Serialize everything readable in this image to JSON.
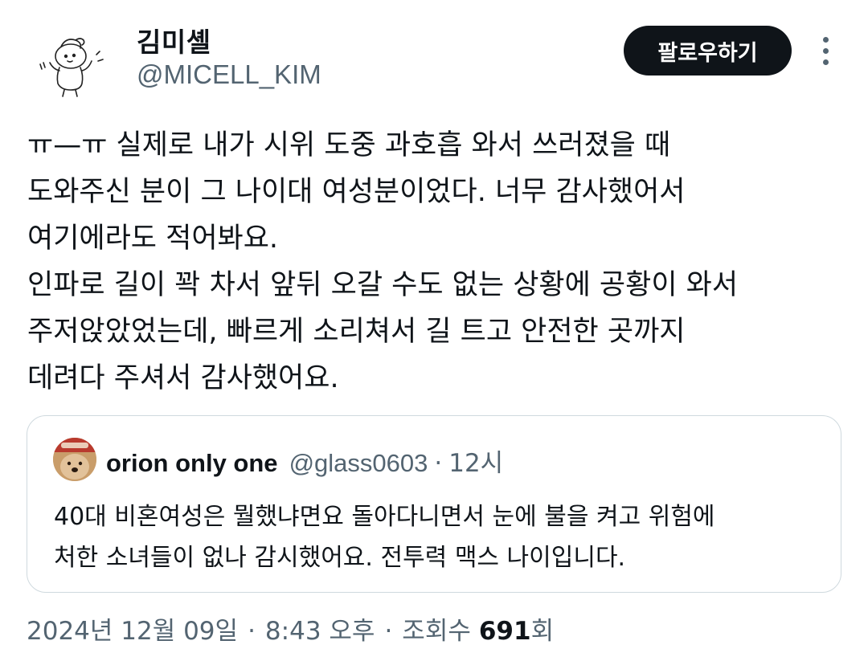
{
  "author": {
    "display_name": "김미셸",
    "handle": "@MICELL_KIM",
    "avatar_icon": "doodle-character-avatar"
  },
  "actions": {
    "follow_label": "팔로우하기",
    "more_icon": "more-vertical-icon"
  },
  "tweet": {
    "text": "ㅠ—ㅠ 실제로 내가 시위 도중 과호흡 와서 쓰러졌을 때\n도와주신 분이 그 나이대 여성분이었다. 너무 감사했어서\n여기에라도 적어봐요.\n인파로 길이 꽉 차서 앞뒤 오갈 수도 없는 상황에 공황이 와서\n주저앉았었는데, 빠르게 소리쳐서 길 트고 안전한 곳까지\n데려다 주셔서 감사했어요."
  },
  "quote": {
    "name": "orion only one",
    "handle": "@glass0603",
    "separator": "·",
    "time": "12시",
    "text": "40대 비혼여성은 뭘했냐면요 돌아다니면서 눈에 불을 켜고 위험에\n처한 소녀들이 없나 감시했어요. 전투력 맥스 나이입니다.",
    "avatar_icon": "dog-photo-avatar"
  },
  "meta": {
    "date": "2024년 12월 09일",
    "separator": "·",
    "time": "8:43 오후",
    "views_label": "조회수",
    "views_count": "691",
    "views_suffix": "회"
  },
  "colors": {
    "text_primary": "#0f1419",
    "text_secondary": "#536471",
    "border": "#cfd9de",
    "button_bg": "#0f1419"
  }
}
